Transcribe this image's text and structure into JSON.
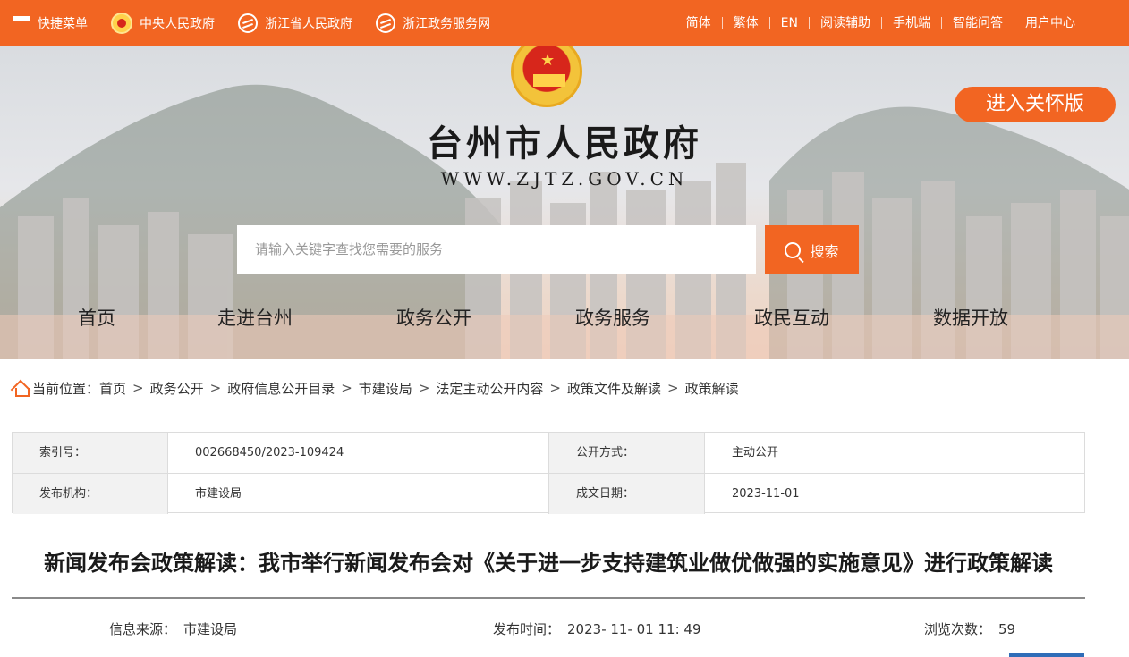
{
  "topbar": {
    "menu_label": "快捷菜单",
    "links": [
      {
        "label": "中央人民政府",
        "icon": "national-emblem-icon"
      },
      {
        "label": "浙江省人民政府",
        "icon": "globe-icon"
      },
      {
        "label": "浙江政务服务网",
        "icon": "globe-icon"
      }
    ],
    "right_links": [
      "简体",
      "繁体",
      "EN",
      "阅读辅助",
      "手机端",
      "智能问答",
      "用户中心"
    ]
  },
  "banner": {
    "title": "台州市人民政府",
    "url": "WWW.ZJTZ.GOV.CN",
    "care_button": "进入关怀版",
    "search_placeholder": "请输入关键字查找您需要的服务",
    "search_button": "搜索"
  },
  "nav": [
    "首页",
    "走进台州",
    "政务公开",
    "政务服务",
    "政民互动",
    "数据开放"
  ],
  "breadcrumb": {
    "prefix": "当前位置：",
    "items": [
      "首页",
      "政务公开",
      "政府信息公开目录",
      "市建设局",
      "法定主动公开内容",
      "政策文件及解读",
      "政策解读"
    ]
  },
  "info": {
    "index_label": "索引号：",
    "index_value": "002668450/2023-109424",
    "open_label": "公开方式：",
    "open_value": "主动公开",
    "publisher_label": "发布机构：",
    "publisher_value": "市建设局",
    "date_label": "成文日期：",
    "date_value": "2023-11-01"
  },
  "article": {
    "headline": "新闻发布会政策解读：我市举行新闻发布会对《关于进一步支持建筑业做优做强的实施意见》进行政策解读",
    "source_label": "信息来源：",
    "source_value": "市建设局",
    "time_label": "发布时间：",
    "time_value": "2023- 11- 01 11: 49",
    "views_label": "浏览次数：",
    "views_value": "59"
  },
  "colors": {
    "accent": "#f26522",
    "text": "#333333"
  }
}
